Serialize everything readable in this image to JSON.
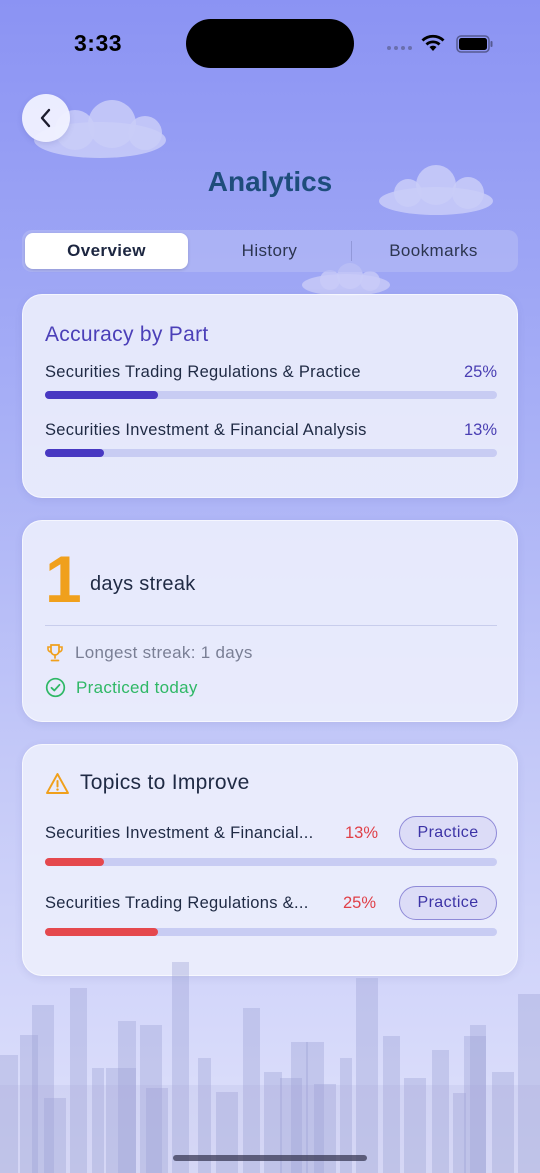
{
  "status": {
    "time": "3:33"
  },
  "header": {
    "title": "Analytics"
  },
  "tabs": [
    {
      "label": "Overview",
      "active": true
    },
    {
      "label": "History",
      "active": false
    },
    {
      "label": "Bookmarks",
      "active": false
    }
  ],
  "accuracy": {
    "title": "Accuracy by Part",
    "parts": [
      {
        "label": "Securities Trading Regulations & Practice",
        "pct": "25%",
        "value": 0.25
      },
      {
        "label": "Securities Investment & Financial Analysis",
        "pct": "13%",
        "value": 0.13
      }
    ]
  },
  "streak": {
    "count": "1",
    "label": "days streak",
    "longest": "Longest streak: 1 days",
    "today": "Practiced today"
  },
  "improve": {
    "title": "Topics to Improve",
    "topics": [
      {
        "label": "Securities Investment & Financial...",
        "pct": "13%",
        "value": 0.13,
        "button": "Practice"
      },
      {
        "label": "Securities Trading Regulations &...",
        "pct": "25%",
        "value": 0.25,
        "button": "Practice"
      }
    ]
  },
  "colors": {
    "accent": "#4838c2",
    "streak": "#f0a01c",
    "success": "#2fb866",
    "danger": "#e5484d",
    "title": "#1e4d7b"
  }
}
